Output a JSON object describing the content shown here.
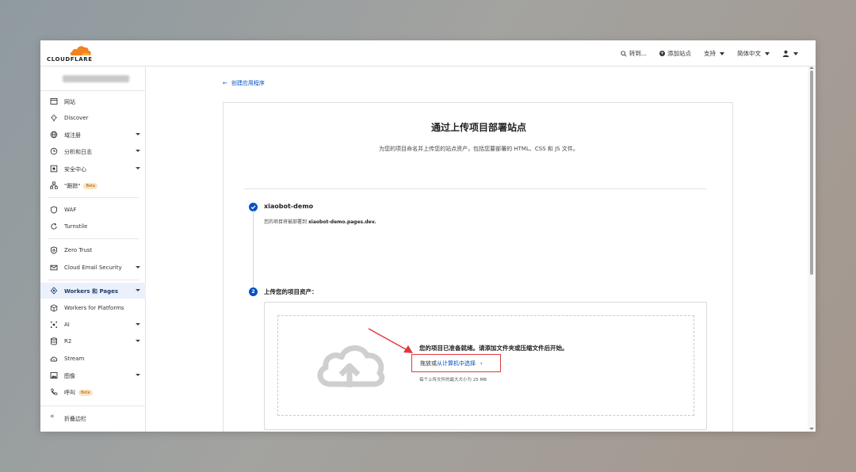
{
  "brand": {
    "logo_text": "CLOUDFLARE",
    "accent": "#f48120"
  },
  "topnav": {
    "goto_label": "转到...",
    "add_site_label": "添加站点",
    "support_label": "支持",
    "language_label": "简体中文",
    "search_icon": "search-icon",
    "user_icon": "user-icon"
  },
  "sidebar": {
    "items": [
      {
        "label": "网站",
        "icon": "browser-icon"
      },
      {
        "label": "Discover",
        "icon": "lightbulb-icon"
      },
      {
        "label": "域注册",
        "icon": "globe-icon"
      },
      {
        "label": "分析和日志",
        "icon": "clock-icon"
      },
      {
        "label": "安全中心",
        "icon": "shield-icon"
      },
      {
        "label": "\"跟踪\"",
        "icon": "sitemap-icon",
        "badge": "Beta"
      },
      {
        "label": "WAF",
        "icon": "waf-shield-icon"
      },
      {
        "label": "Turnstile",
        "icon": "refresh-icon"
      },
      {
        "label": "Zero Trust",
        "icon": "zero-trust-icon"
      },
      {
        "label": "Cloud Email Security",
        "icon": "email-icon"
      },
      {
        "label": "Workers 和 Pages",
        "icon": "workers-icon"
      },
      {
        "label": "Workers for Platforms",
        "icon": "cube-icon"
      },
      {
        "label": "AI",
        "icon": "ai-icon"
      },
      {
        "label": "R2",
        "icon": "database-icon"
      },
      {
        "label": "Stream",
        "icon": "stream-icon"
      },
      {
        "label": "图像",
        "icon": "image-icon"
      },
      {
        "label": "呼叫",
        "icon": "phone-icon",
        "badge": "Beta"
      }
    ],
    "collapse_label": "折叠边栏"
  },
  "main": {
    "back_label": "创建应用程序",
    "title": "通过上传项目部署站点",
    "description": "为您的项目命名并上传您的站点资产，包括您要部署的 HTML、CSS 和 JS 文件。",
    "step1": {
      "name": "xiaobot-demo",
      "note_prefix": "您的项目将被部署到",
      "domain": "xiaobot-demo.pages.dev."
    },
    "step2": {
      "number": "2",
      "title": "上传您的项目资产：",
      "ready_text": "您的项目已准备就绪。请添加文件夹或压缩文件后开始。",
      "drag_text": "拖放或",
      "select_text": "从计算机中选择",
      "limit_text": "每个上传文件的最大大小为 25 MB"
    }
  }
}
